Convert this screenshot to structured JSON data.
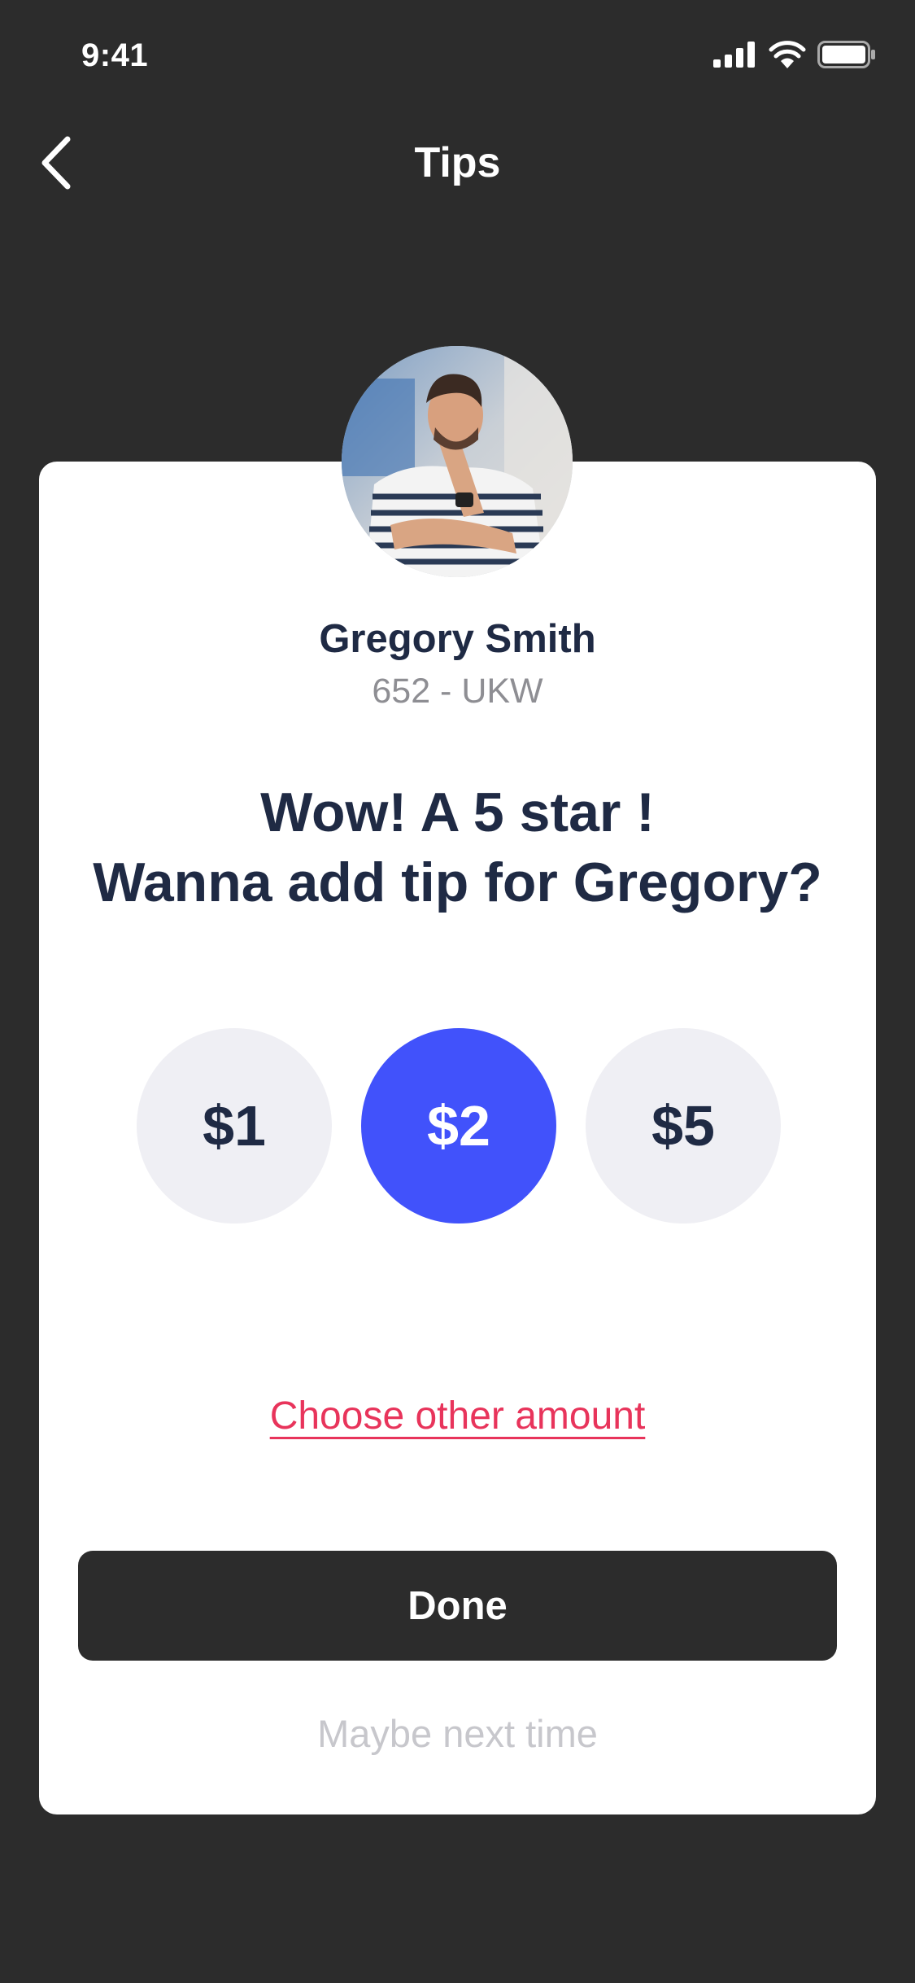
{
  "status_bar": {
    "time": "9:41",
    "icons": [
      "cellular-signal-icon",
      "wifi-icon",
      "battery-icon"
    ]
  },
  "nav": {
    "back_icon": "chevron-left-icon",
    "title": "Tips"
  },
  "driver": {
    "avatar": "driver-avatar-photo",
    "name": "Gregory Smith",
    "plate": "652 - UKW"
  },
  "headline": {
    "line1": "Wow! A 5 star !",
    "line2": "Wanna add tip for Gregory?"
  },
  "tips": {
    "options": [
      "$1",
      "$2",
      "$5"
    ],
    "selected": "$2"
  },
  "other_amount_label": "Choose other amount",
  "done_label": "Done",
  "maybe_later_label": "Maybe next time",
  "colors": {
    "background": "#2c2c2c",
    "card": "#ffffff",
    "accent": "#4152fb",
    "link": "#e8345b",
    "text_primary": "#1f2a44",
    "text_secondary": "#8e8e93",
    "tip_option_bg": "#efeff4",
    "muted": "#c7c7cc"
  }
}
